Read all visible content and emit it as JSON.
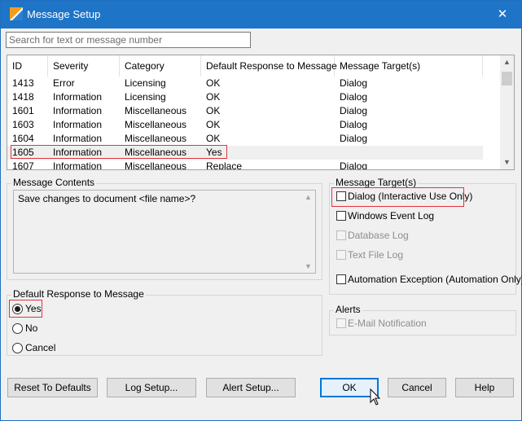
{
  "window": {
    "title": "Message Setup",
    "close_glyph": "✕"
  },
  "search": {
    "placeholder": "Search for text or message number",
    "value": ""
  },
  "table": {
    "columns": [
      "ID",
      "Severity",
      "Category",
      "Default Response to Message",
      "Message Target(s)"
    ],
    "rows": [
      [
        "1413",
        "Error",
        "Licensing",
        "OK",
        "Dialog"
      ],
      [
        "1418",
        "Information",
        "Licensing",
        "OK",
        "Dialog"
      ],
      [
        "1601",
        "Information",
        "Miscellaneous",
        "OK",
        "Dialog"
      ],
      [
        "1603",
        "Information",
        "Miscellaneous",
        "OK",
        "Dialog"
      ],
      [
        "1604",
        "Information",
        "Miscellaneous",
        "OK",
        "Dialog"
      ],
      [
        "1605",
        "Information",
        "Miscellaneous",
        "Yes",
        ""
      ],
      [
        "1607",
        "Information",
        "Miscellaneous",
        "Replace",
        "Dialog"
      ]
    ],
    "selected_id": "1605"
  },
  "message_contents": {
    "label": "Message Contents",
    "text": "Save changes to document <file name>?"
  },
  "message_targets": {
    "label": "Message Target(s)",
    "options": [
      {
        "label": "Dialog (Interactive Use Only)",
        "checked": false,
        "enabled": true
      },
      {
        "label": "Windows Event Log",
        "checked": false,
        "enabled": true
      },
      {
        "label": "Database Log",
        "checked": false,
        "enabled": false
      },
      {
        "label": "Text File Log",
        "checked": false,
        "enabled": false
      },
      {
        "label": "Automation Exception (Automation Only)",
        "checked": false,
        "enabled": true
      }
    ]
  },
  "default_response": {
    "label": "Default Response to Message",
    "options": [
      "Yes",
      "No",
      "Cancel"
    ],
    "selected": "Yes"
  },
  "alerts": {
    "label": "Alerts",
    "options": [
      {
        "label": "E-Mail Notification",
        "checked": false,
        "enabled": false
      }
    ]
  },
  "buttons": {
    "reset": "Reset To Defaults",
    "log_setup": "Log Setup...",
    "alert_setup": "Alert Setup...",
    "ok": "OK",
    "cancel": "Cancel",
    "help": "Help"
  },
  "colors": {
    "titlebar": "#1e74c6",
    "highlight": "#e0343c",
    "default_button_border": "#0078d7"
  }
}
